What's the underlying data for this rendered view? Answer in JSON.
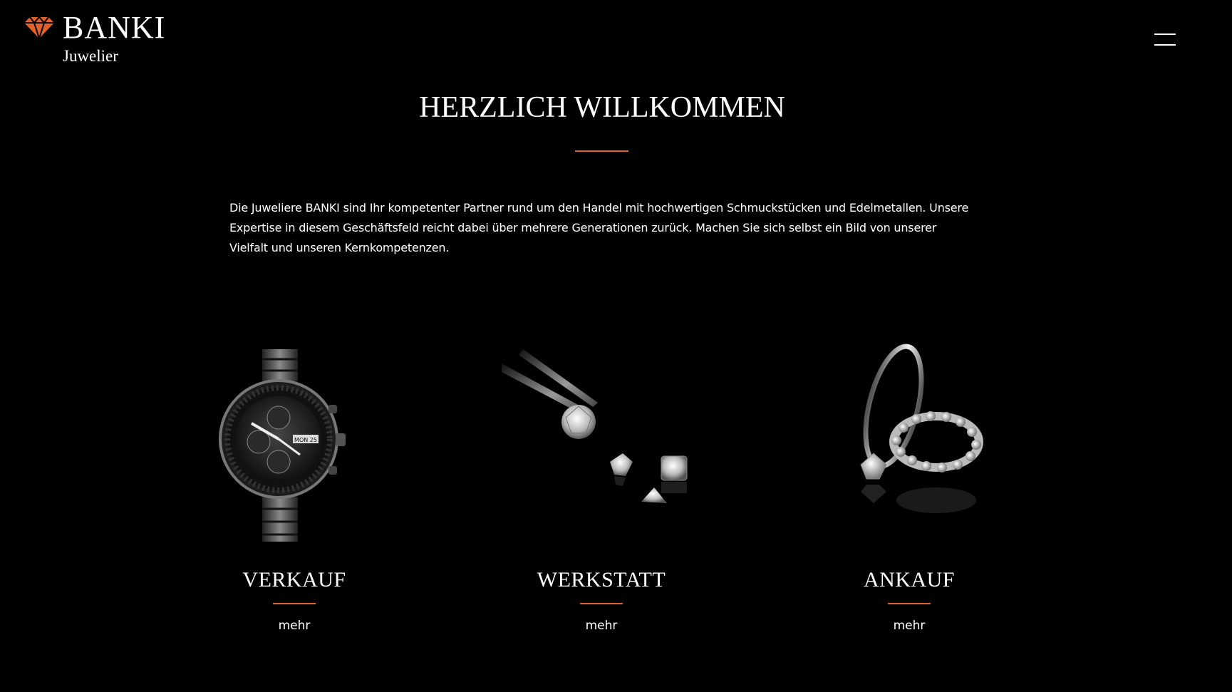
{
  "header": {
    "brand": "BANKI",
    "subtitle": "Juwelier",
    "logo_icon": "diamond-icon",
    "menu_icon": "hamburger-menu-icon"
  },
  "welcome": {
    "title": "HERZLICH WILLKOMMEN",
    "text": "Die Juweliere BANKI sind Ihr kompetenter Partner rund um den Handel mit hochwertigen Schmuckstücken und Edelmetallen. Unsere Expertise in diesem Geschäftsfeld reicht dabei über mehrere Generationen zurück. Machen Sie sich selbst ein Bild von unserer Vielfalt und unseren Kernkompetenzen."
  },
  "cards": [
    {
      "title": "VERKAUF",
      "link": "mehr",
      "image": "watch-image"
    },
    {
      "title": "WERKSTATT",
      "link": "mehr",
      "image": "diamonds-image"
    },
    {
      "title": "ANKAUF",
      "link": "mehr",
      "image": "rings-image"
    }
  ],
  "colors": {
    "background": "#000000",
    "text": "#ffffff",
    "accent": "#e0612a"
  }
}
